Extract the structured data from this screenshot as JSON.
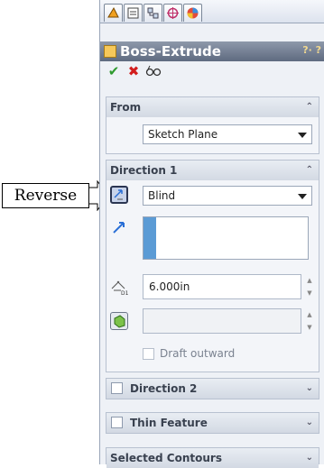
{
  "callout": {
    "label": "Reverse"
  },
  "panel": {
    "tabs": [
      {
        "icon": "feature-manager-icon"
      },
      {
        "icon": "property-manager-icon"
      },
      {
        "icon": "configuration-manager-icon"
      },
      {
        "icon": "dimxpert-icon"
      },
      {
        "icon": "display-manager-icon"
      }
    ],
    "title": "Boss-Extrude",
    "help": "?· ?",
    "actions": {
      "ok_icon": "check-icon",
      "cancel_icon": "cross-icon",
      "preview_icon": "eyeglasses-icon"
    }
  },
  "from": {
    "header": "From",
    "start_condition": "Sketch Plane"
  },
  "direction1": {
    "header": "Direction 1",
    "end_condition": "Blind",
    "depth": "6.000in",
    "draft_outward": "Draft outward"
  },
  "direction2": {
    "header": "Direction 2"
  },
  "thin_feature": {
    "header": "Thin Feature"
  },
  "selected_contours": {
    "header": "Selected Contours"
  },
  "colors": {
    "titlebar": "#6c778b",
    "ok": "#2e9a2e",
    "cancel": "#d21d1d",
    "accent": "#5b9bd5"
  }
}
